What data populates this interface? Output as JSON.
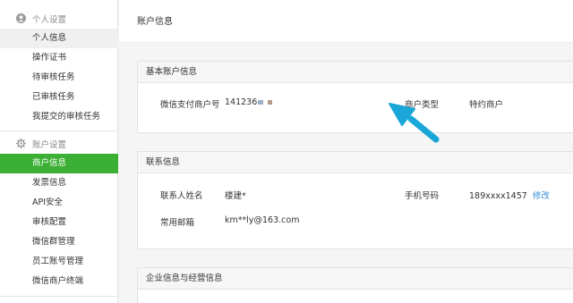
{
  "sidebar": {
    "personal": {
      "heading": "个人设置",
      "items": [
        "个人信息",
        "操作证书",
        "待审核任务",
        "已审核任务",
        "我提交的审核任务"
      ]
    },
    "account": {
      "heading": "账户设置",
      "items": [
        "商户信息",
        "发票信息",
        "API安全",
        "审核配置",
        "微信群管理",
        "员工账号管理",
        "微信商户终端"
      ]
    }
  },
  "main": {
    "title": "账户信息",
    "basic": {
      "heading": "基本账户信息",
      "merchant_id_label": "微信支付商户号",
      "merchant_id_value": "141236",
      "merchant_type_label": "商户类型",
      "merchant_type_value": "特约商户"
    },
    "contact": {
      "heading": "联系信息",
      "name_label": "联系人姓名",
      "name_value": "楼建*",
      "phone_label": "手机号码",
      "phone_value": "189xxxx1457",
      "modify_link": "修改",
      "email_label": "常用邮箱",
      "email_value": "km**ly@163.com"
    },
    "enterprise": {
      "heading": "企业信息与经营信息"
    }
  },
  "colors": {
    "active_nav": "#3cb034",
    "link": "#3a8fd6",
    "annotation_arrow": "#1aa6d8"
  }
}
